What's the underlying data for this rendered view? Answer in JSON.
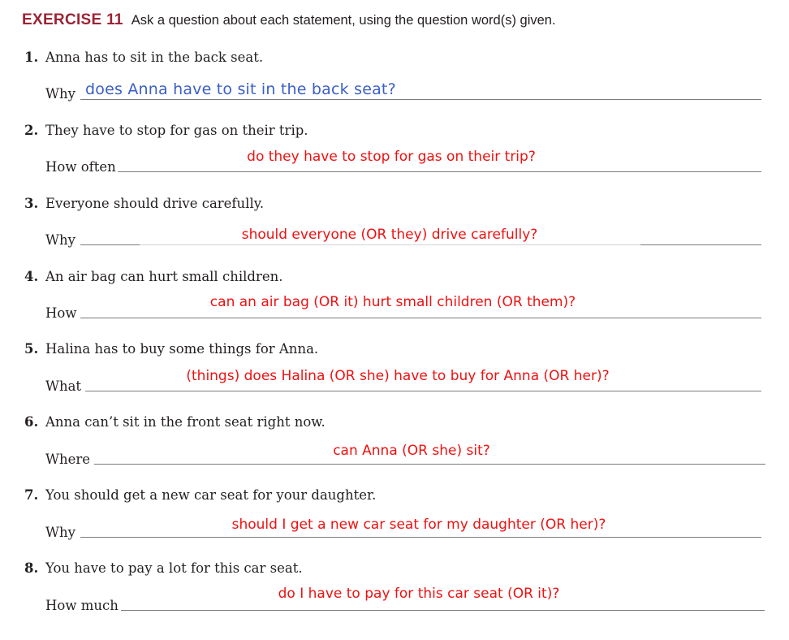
{
  "header": {
    "exercise_label": "EXERCISE 11",
    "instruction": "Ask a question about each statement, using the question word(s) given."
  },
  "items": [
    {
      "number": "1.",
      "statement": "Anna has to sit in the back seat.",
      "question_word": "Why",
      "answer": "does Anna have to sit in the back seat?"
    },
    {
      "number": "2.",
      "statement": "They have to stop for gas on their trip.",
      "question_word": "How often",
      "answer": "do they have to stop for gas on their trip?"
    },
    {
      "number": "3.",
      "statement": "Everyone should drive carefully.",
      "question_word": "Why",
      "answer": "should everyone (OR they) drive carefully?"
    },
    {
      "number": "4.",
      "statement": "An air bag can hurt small children.",
      "question_word": "How",
      "answer": "can an air bag (OR it) hurt small children (OR them)?"
    },
    {
      "number": "5.",
      "statement": "Halina has to buy some things for Anna.",
      "question_word": "What",
      "answer": "(things) does Halina (OR she) have to buy for Anna (OR her)?"
    },
    {
      "number": "6.",
      "statement": "Anna can’t sit in the front seat right now.",
      "question_word": "Where",
      "answer": "can Anna (OR she) sit?"
    },
    {
      "number": "7.",
      "statement": "You should get a new car seat for your daughter.",
      "question_word": "Why",
      "answer": "should I get a new car seat for my daughter (OR her)?"
    },
    {
      "number": "8.",
      "statement": "You have to pay a lot for this car seat.",
      "question_word": "How much",
      "answer": "do I have to pay for this car seat (OR it)?"
    }
  ],
  "colors": {
    "exercise_label": "#9b2335",
    "answer_red": "#ee1111",
    "answer_blue": "#3a5fc8"
  }
}
